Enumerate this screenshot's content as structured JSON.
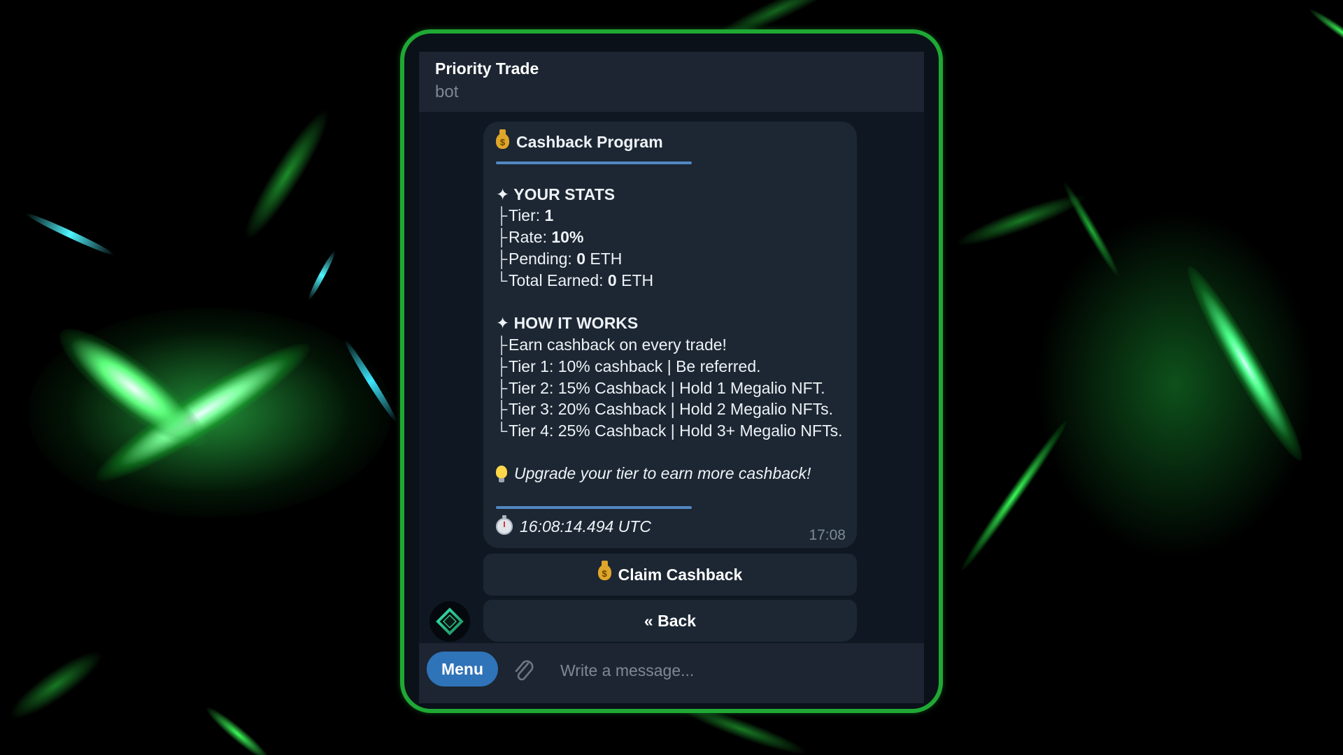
{
  "header": {
    "title": "Priority Trade",
    "subtitle": "bot"
  },
  "message": {
    "heading": "Cashback Program",
    "stats_title": "YOUR STATS",
    "stats": {
      "tier_label": "Tier:",
      "tier_value": "1",
      "rate_label": "Rate:",
      "rate_value": "10%",
      "pending_label": "Pending:",
      "pending_value": "0",
      "pending_unit": "ETH",
      "total_label": "Total Earned:",
      "total_value": "0",
      "total_unit": "ETH"
    },
    "how_title": "HOW IT WORKS",
    "how_items": [
      "Earn cashback on every trade!",
      "Tier 1: 10% cashback | Be referred.",
      "Tier 2: 15% Cashback | Hold 1 Megalio NFT.",
      "Tier 3: 20% Cashback | Hold 2 Megalio NFTs.",
      "Tier 4: 25% Cashback | Hold 3+ Megalio NFTs."
    ],
    "tip": "Upgrade your tier to earn more cashback!",
    "timestamp": "16:08:14.494 UTC",
    "time": "17:08",
    "bullet": "✦",
    "tree_mid": "├",
    "tree_end": "└"
  },
  "keyboard": {
    "claim": "Claim Cashback",
    "back": "« Back"
  },
  "composer": {
    "menu": "Menu",
    "placeholder": "Write a message..."
  },
  "icons": {
    "money_bag": "money-bag-icon",
    "bulb": "light-bulb-icon",
    "stopwatch": "stopwatch-icon",
    "paperclip": "paperclip-icon",
    "avatar": "bot-avatar-icon"
  },
  "colors": {
    "frame_border": "#1fa834",
    "panel_bg": "#0f1822",
    "bubble_bg": "#1c2733",
    "accent_bar": "#5288c1",
    "menu_button": "#2f73b9",
    "header_bg": "#1c2531"
  }
}
